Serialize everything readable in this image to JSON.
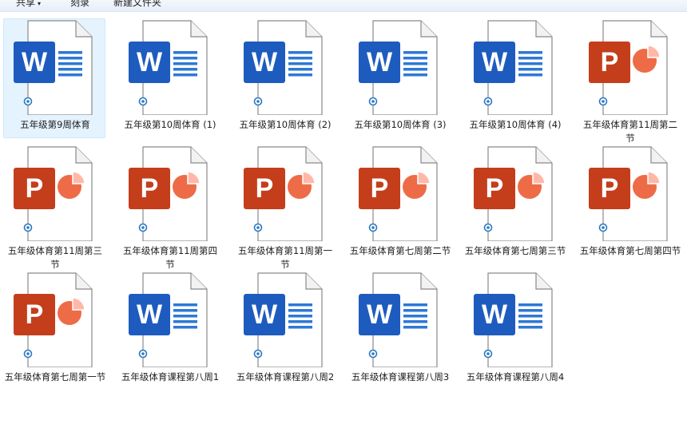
{
  "toolbar": {
    "buttons": [
      {
        "label": "共享",
        "caret": "▾"
      },
      {
        "label": "刻录"
      },
      {
        "label": "新建文件夹"
      }
    ]
  },
  "files": [
    {
      "name": "五年级第9周体育",
      "type": "word",
      "selected": true
    },
    {
      "name": "五年级第10周体育 (1)",
      "type": "word"
    },
    {
      "name": "五年级第10周体育 (2)",
      "type": "word"
    },
    {
      "name": "五年级第10周体育 (3)",
      "type": "word"
    },
    {
      "name": "五年级第10周体育 (4)",
      "type": "word"
    },
    {
      "name": "五年级体育第11周第二节",
      "type": "ppt"
    },
    {
      "name": "五年级体育第11周第三节",
      "type": "ppt"
    },
    {
      "name": "五年级体育第11周第四节",
      "type": "ppt"
    },
    {
      "name": "五年级体育第11周第一节",
      "type": "ppt"
    },
    {
      "name": "五年级体育第七周第二节",
      "type": "ppt"
    },
    {
      "name": "五年级体育第七周第三节",
      "type": "ppt"
    },
    {
      "name": "五年级体育第七周第四节",
      "type": "ppt"
    },
    {
      "name": "五年级体育第七周第一节",
      "type": "ppt"
    },
    {
      "name": "五年级体育课程第八周1",
      "type": "word"
    },
    {
      "name": "五年级体育课程第八周2",
      "type": "word"
    },
    {
      "name": "五年级体育课程第八周3",
      "type": "word"
    },
    {
      "name": "五年级体育课程第八周4",
      "type": "word"
    }
  ],
  "colors": {
    "word": "#1e5bbf",
    "word_lines": "#2e78d6",
    "ppt": "#c43e1c",
    "ppt_pie": "#ed6c47",
    "ppt_pie_light": "#ffb8a8",
    "selection": "#e5f3ff"
  },
  "icons": {
    "word": "word-document-icon",
    "ppt": "powerpoint-document-icon",
    "sync": "cloud-sync-icon"
  }
}
